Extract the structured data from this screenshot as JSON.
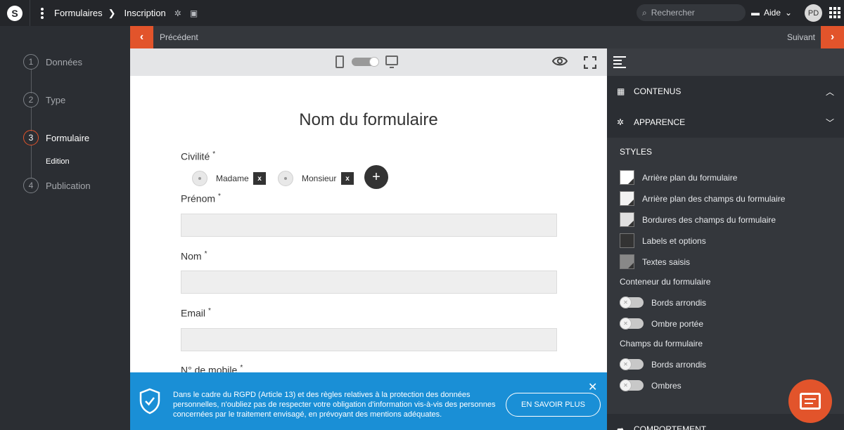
{
  "topbar": {
    "breadcrumb_root": "Formulaires",
    "breadcrumb_current": "Inscription",
    "search_placeholder": "Rechercher",
    "help_label": "Aide",
    "avatar_initials": "PD"
  },
  "steps": [
    {
      "num": "1",
      "label": "Données"
    },
    {
      "num": "2",
      "label": "Type"
    },
    {
      "num": "3",
      "label": "Formulaire",
      "active": true
    },
    {
      "num": "4",
      "label": "Publication"
    }
  ],
  "substep_label": "Edition",
  "nav": {
    "prev_label": "Précédent",
    "next_label": "Suivant"
  },
  "form": {
    "title": "Nom du formulaire",
    "required_mark": "*",
    "civility_label": "Civilité",
    "options": [
      "Madame",
      "Monsieur"
    ],
    "fields": [
      "Prénom",
      "Nom",
      "Email",
      "N° de mobile"
    ]
  },
  "rgpd": {
    "text": "Dans le cadre du RGPD (Article 13) et des règles relatives à la protection des données personnelles, n'oubliez pas de respecter votre obligation d'information vis-à-vis des personnes concernées par le traitement envisagé, en prévoyant des mentions adéquates.",
    "button_label": "EN SAVOIR PLUS"
  },
  "panel": {
    "contents_label": "CONTENUS",
    "appearance_label": "APPARENCE",
    "styles_label": "STYLES",
    "style_items": [
      {
        "label": "Arrière plan du formulaire",
        "color": "#ffffff"
      },
      {
        "label": "Arrière plan des champs du formulaire",
        "color": "#f2f2f2"
      },
      {
        "label": "Bordures des champs du formulaire",
        "color": "#e0e0e0"
      },
      {
        "label": "Labels et options",
        "color": "#333333"
      },
      {
        "label": "Textes saisis",
        "color": "#888888"
      }
    ],
    "container_label": "Conteneur du formulaire",
    "container_toggles": [
      "Bords arrondis",
      "Ombre portée"
    ],
    "fields_label": "Champs du formulaire",
    "field_toggles": [
      "Bords arrondis",
      "Ombres"
    ],
    "behavior_label": "COMPORTEMENT"
  },
  "colors": {
    "accent": "#e2542b",
    "banner": "#1a8fd6"
  }
}
